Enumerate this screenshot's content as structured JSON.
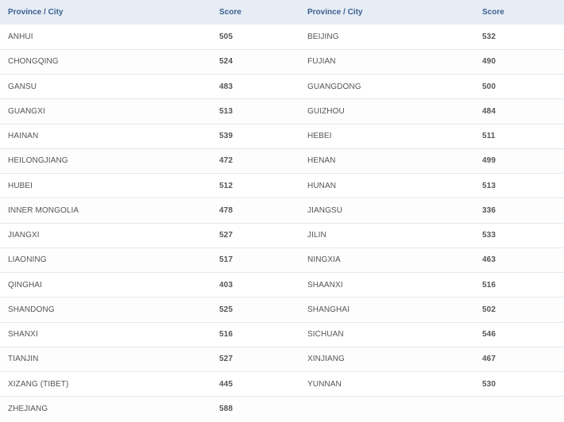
{
  "headers": {
    "province1": "Province / City",
    "score1": "Score",
    "province2": "Province / City",
    "score2": "Score"
  },
  "rows": [
    {
      "p1": "ANHUI",
      "s1": "505",
      "p2": "BEIJING",
      "s2": "532"
    },
    {
      "p1": "CHONGQING",
      "s1": "524",
      "p2": "FUJIAN",
      "s2": "490"
    },
    {
      "p1": "GANSU",
      "s1": "483",
      "p2": "GUANGDONG",
      "s2": "500"
    },
    {
      "p1": "GUANGXI",
      "s1": "513",
      "p2": "GUIZHOU",
      "s2": "484"
    },
    {
      "p1": "HAINAN",
      "s1": "539",
      "p2": "HEBEI",
      "s2": "511"
    },
    {
      "p1": "HEILONGJIANG",
      "s1": "472",
      "p2": "HENAN",
      "s2": "499"
    },
    {
      "p1": "HUBEI",
      "s1": "512",
      "p2": "HUNAN",
      "s2": "513"
    },
    {
      "p1": "INNER MONGOLIA",
      "s1": "478",
      "p2": "JIANGSU",
      "s2": "336"
    },
    {
      "p1": "JIANGXI",
      "s1": "527",
      "p2": "JILIN",
      "s2": "533"
    },
    {
      "p1": "LIAONING",
      "s1": "517",
      "p2": "NINGXIA",
      "s2": "463"
    },
    {
      "p1": "QINGHAI",
      "s1": "403",
      "p2": "SHAANXI",
      "s2": "516"
    },
    {
      "p1": "SHANDONG",
      "s1": "525",
      "p2": "SHANGHAI",
      "s2": "502"
    },
    {
      "p1": "SHANXI",
      "s1": "516",
      "p2": "SICHUAN",
      "s2": "546"
    },
    {
      "p1": "TIANJIN",
      "s1": "527",
      "p2": "XINJIANG",
      "s2": "467"
    },
    {
      "p1": "XIZANG (TIBET)",
      "s1": "445",
      "p2": "YUNNAN",
      "s2": "530"
    },
    {
      "p1": "ZHEJIANG",
      "s1": "588",
      "p2": "",
      "s2": ""
    }
  ],
  "colors": {
    "header_bg": "#e6edf5",
    "header_text": "#3c5f8f",
    "row_border": "#e4e8ee"
  }
}
